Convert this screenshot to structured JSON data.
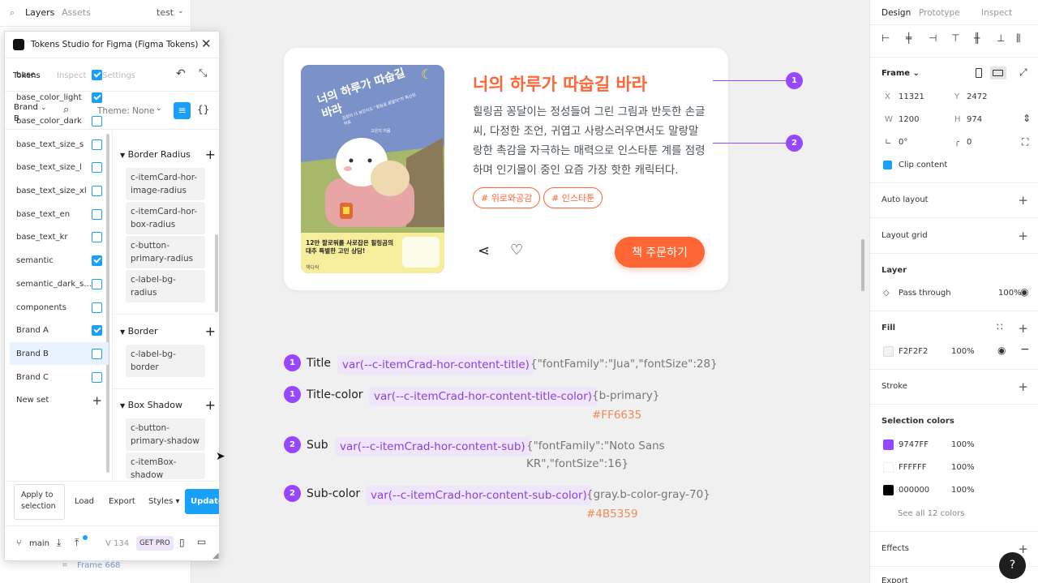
{
  "layers_panel": {
    "tab_layers": "Layers",
    "tab_assets": "Assets",
    "page_name": "test",
    "bottom_frame_label": "Frame 668"
  },
  "plugin": {
    "title": "Tokens Studio for Figma (Figma Tokens)",
    "tabs": [
      "Tokens",
      "Inspect",
      "Settings"
    ],
    "brand_select": "Brand B",
    "theme_label": "Theme: None",
    "token_sets": [
      {
        "name": "base",
        "checked": true,
        "selected": false
      },
      {
        "name": "base_color_light",
        "checked": true,
        "selected": false
      },
      {
        "name": "base_color_dark",
        "checked": false,
        "selected": false
      },
      {
        "name": "base_text_size_s",
        "checked": false,
        "selected": false
      },
      {
        "name": "base_text_size_l",
        "checked": false,
        "selected": false
      },
      {
        "name": "base_text_size_xl",
        "checked": false,
        "selected": false
      },
      {
        "name": "base_text_en",
        "checked": false,
        "selected": false
      },
      {
        "name": "base_text_kr",
        "checked": false,
        "selected": false
      },
      {
        "name": "semantic",
        "checked": true,
        "selected": false
      },
      {
        "name": "semantic_dark_s...",
        "checked": false,
        "selected": false
      },
      {
        "name": "components",
        "checked": false,
        "selected": false
      },
      {
        "name": "Brand A",
        "checked": true,
        "selected": false
      },
      {
        "name": "Brand B",
        "checked": false,
        "selected": true
      },
      {
        "name": "Brand C",
        "checked": false,
        "selected": false
      }
    ],
    "new_set_label": "New set",
    "groups": {
      "border_radius": {
        "title": "Border Radius",
        "tokens": [
          "c-itemCard-hor-image-radius",
          "c-itemCard-hor-box-radius",
          "c-button-primary-radius",
          "c-label-bg-radius"
        ]
      },
      "border": {
        "title": "Border",
        "tokens": [
          "c-label-bg-border"
        ]
      },
      "box_shadow": {
        "title": "Box Shadow",
        "tokens": [
          "c-button-primary-shadow",
          "c-itemBox-shadow"
        ]
      }
    },
    "footer": {
      "apply_label": "Apply to selection",
      "load_label": "Load",
      "export_label": "Export",
      "styles_label": "Styles",
      "update_label": "Update",
      "branch": "main",
      "version": "V 134",
      "get_pro": "GET PRO"
    }
  },
  "card": {
    "title": "너의 하루가 따숩길 바라",
    "description": "힐링곰 꽁달이는 정성들여 그린 그림과 반듯한 손글씨, 다정한 조언, 귀엽고 사랑스러우면서도 말랑말랑한 촉감을 자극하는 매력으로 인스타툰 계를 점령하며 인기몰이 중인 요즘 가장 핫한 캐릭터다.",
    "tags": [
      "# 위로와공감",
      "# 인스타툰"
    ],
    "order_button": "책 주문하기",
    "cover": {
      "title": "너의 하루가 따숩길 바라",
      "subtitle": "검정이 더 보던지도 \"힐링곰 꽁달이\"의 특산된 위로",
      "author": "고은지 지음",
      "banner_headline": "12만 팔로워를 사로잡은 힐링곰의 대추 특별한 고민 상담!",
      "publisher": "책다락"
    },
    "callouts": [
      "1",
      "2"
    ]
  },
  "specs": [
    {
      "num": "1",
      "label": "Title",
      "var": "var(--c-itemCrad-hor-content-title)",
      "value": "{\"fontFamily\":\"Jua\",\"fontSize\":28}",
      "hex": ""
    },
    {
      "num": "1",
      "label": "Title-color",
      "var": "var(--c-itemCrad-hor-content-title-color)",
      "value": "{b-primary}",
      "hex": "#FF6635"
    },
    {
      "num": "2",
      "label": "Sub",
      "var": "var(--c-itemCrad-hor-content-sub)",
      "value": "{\"fontFamily\":\"Noto Sans KR\",\"fontSize\":16}",
      "hex": ""
    },
    {
      "num": "2",
      "label": "Sub-color",
      "var": "var(--c-itemCrad-hor-content-sub-color)",
      "value": "{gray.b-color-gray-70}",
      "hex": "#4B5359"
    }
  ],
  "design_panel": {
    "tabs": [
      "Design",
      "Prototype",
      "Inspect"
    ],
    "frame_label": "Frame",
    "x_label": "X",
    "x": "11321",
    "y_label": "Y",
    "y": "2472",
    "w_label": "W",
    "w": "1200",
    "h_label": "H",
    "h": "974",
    "rotation": "0°",
    "radius": "0",
    "clip_content": "Clip content",
    "auto_layout": "Auto layout",
    "layout_grid": "Layout grid",
    "layer": "Layer",
    "blend": "Pass through",
    "layer_opacity": "100%",
    "fill": "Fill",
    "fill_hex": "F2F2F2",
    "fill_opacity": "100%",
    "stroke": "Stroke",
    "selection_colors": "Selection colors",
    "colors": [
      {
        "hex": "9747FF",
        "opacity": "100%",
        "color": "#9747FF"
      },
      {
        "hex": "FFFFFF",
        "opacity": "100%",
        "color": "#FFFFFF"
      },
      {
        "hex": "000000",
        "opacity": "100%",
        "color": "#000000"
      }
    ],
    "see_all": "See all 12 colors",
    "effects": "Effects",
    "export": "Export",
    "help": "?"
  },
  "colors": {
    "accent": "#FF6635",
    "purple": "#9747FF",
    "blue": "#18A0FB"
  }
}
